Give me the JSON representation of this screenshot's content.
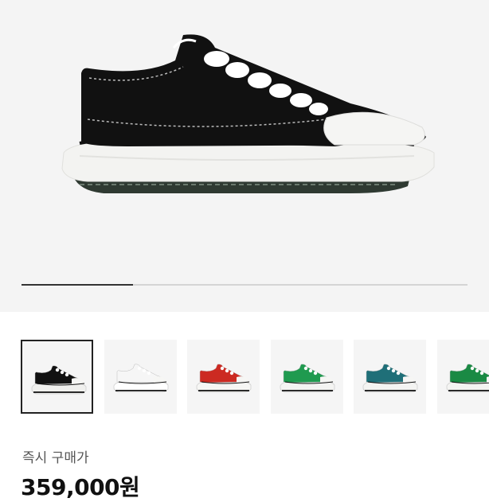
{
  "product": {
    "images": [
      {
        "name": "black",
        "colors": {
          "upper": "#111111",
          "sole": "#f0f0ee",
          "lace": "#ffffff"
        }
      },
      {
        "name": "white",
        "colors": {
          "upper": "#f6f6f6",
          "sole": "#ffffff",
          "lace": "#ffffff"
        }
      },
      {
        "name": "red",
        "colors": {
          "upper": "#cc2a22",
          "sole": "#f6f6f4",
          "lace": "#ffffff"
        }
      },
      {
        "name": "green",
        "colors": {
          "upper": "#1f9a4f",
          "sole": "#f4f4f2",
          "lace": "#ffffff"
        }
      },
      {
        "name": "teal",
        "colors": {
          "upper": "#1f6f78",
          "sole": "#f4f4f2",
          "lace": "#ffffff"
        }
      },
      {
        "name": "green-2",
        "colors": {
          "upper": "#1a8a44",
          "sole": "#f4f4f2",
          "lace": "#ffffff"
        }
      }
    ],
    "selected_index": 0,
    "gallery_progress": 0.25
  },
  "purchase": {
    "label": "즉시 구매가",
    "price": "359,000원"
  }
}
